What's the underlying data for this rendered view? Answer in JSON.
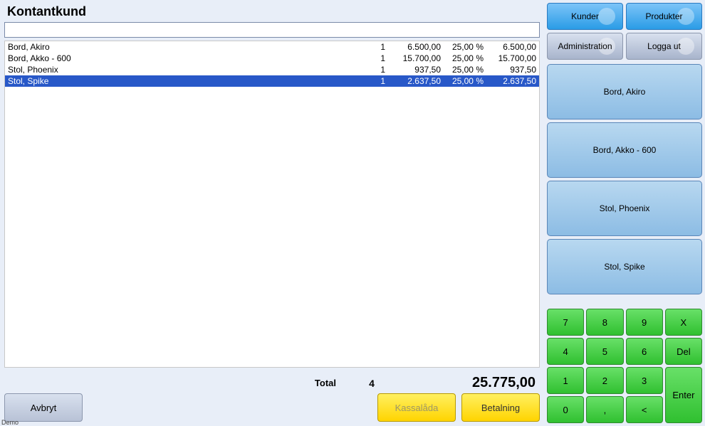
{
  "title": "Kontantkund",
  "search_value": "",
  "lines": [
    {
      "name": "Bord, Akiro",
      "qty": "1",
      "price": "6.500,00",
      "vat": "25,00 %",
      "total": "6.500,00",
      "selected": false
    },
    {
      "name": "Bord, Akko - 600",
      "qty": "1",
      "price": "15.700,00",
      "vat": "25,00 %",
      "total": "15.700,00",
      "selected": false
    },
    {
      "name": "Stol, Phoenix",
      "qty": "1",
      "price": "937,50",
      "vat": "25,00 %",
      "total": "937,50",
      "selected": false
    },
    {
      "name": "Stol, Spike",
      "qty": "1",
      "price": "2.637,50",
      "vat": "25,00 %",
      "total": "2.637,50",
      "selected": true
    }
  ],
  "totals": {
    "label": "Total",
    "qty": "4",
    "amount": "25.775,00"
  },
  "buttons": {
    "cancel": "Avbryt",
    "drawer": "Kassalåda",
    "pay": "Betalning"
  },
  "side": {
    "kunder": "Kunder",
    "produkter": "Produkter",
    "admin": "Administration",
    "logout": "Logga ut"
  },
  "products": [
    "Bord, Akiro",
    "Bord, Akko - 600",
    "Stol, Phoenix",
    "Stol, Spike"
  ],
  "keypad": {
    "k7": "7",
    "k8": "8",
    "k9": "9",
    "kx": "X",
    "k4": "4",
    "k5": "5",
    "k6": "6",
    "kdel": "Del",
    "k1": "1",
    "k2": "2",
    "k3": "3",
    "kenter": "Enter",
    "k0": "0",
    "kcomma": ",",
    "kback": "<"
  },
  "corner": "Demo"
}
